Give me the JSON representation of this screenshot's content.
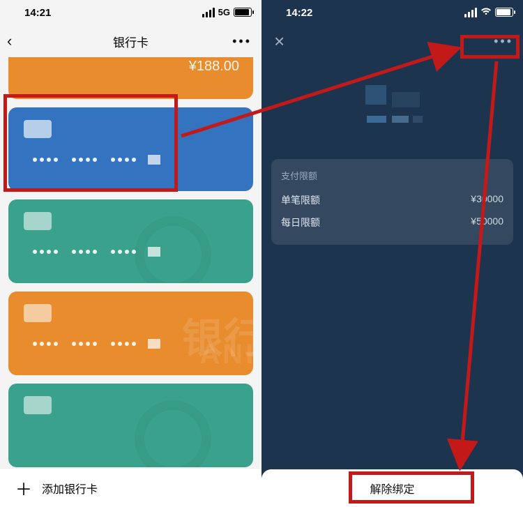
{
  "left": {
    "time": "14:21",
    "signal_label": "5G",
    "page_title": "银行卡",
    "top_amount": "¥188.00",
    "bgtext_line1": "银行",
    "bgtext_line2": "ANK",
    "add_label": "添加银行卡"
  },
  "right": {
    "time": "14:22",
    "limits": {
      "title": "支付限额",
      "rows": [
        {
          "label": "单笔限额",
          "value": "¥30000"
        },
        {
          "label": "每日限额",
          "value": "¥50000"
        }
      ]
    },
    "unbind_label": "解除绑定"
  }
}
